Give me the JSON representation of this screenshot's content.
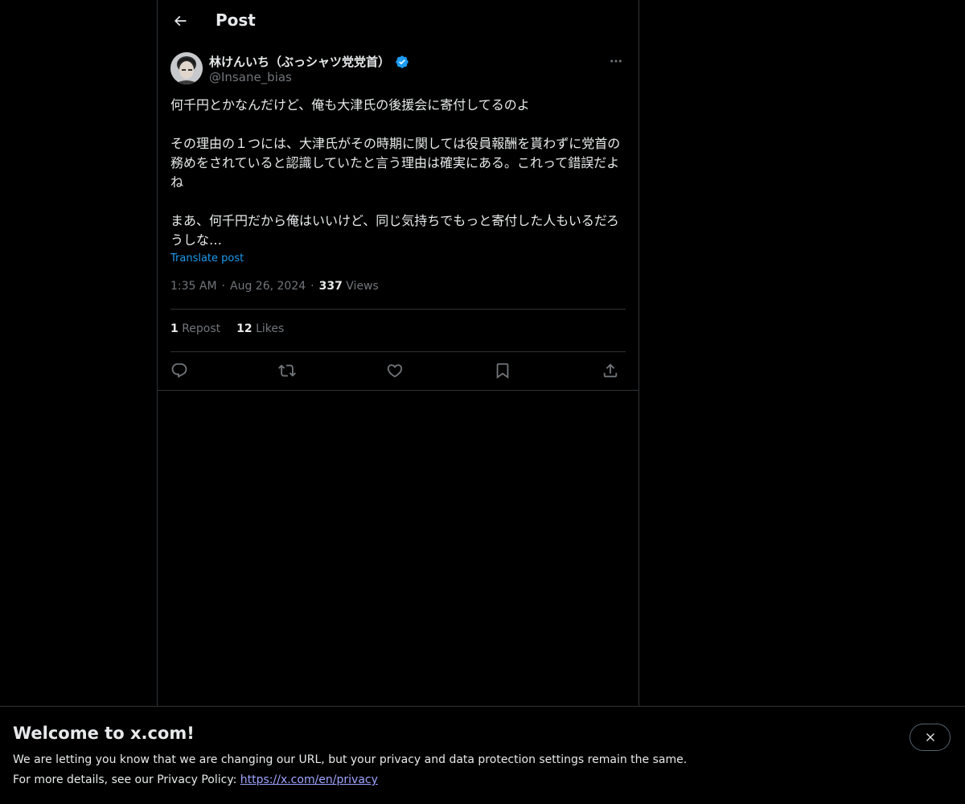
{
  "header": {
    "title": "Post",
    "back_icon": "arrow-left-icon"
  },
  "post": {
    "author": {
      "display_name": "林けんいち（ぶっシャツ党党首）",
      "handle": "@Insane_bias",
      "verified": true
    },
    "paragraphs": [
      "何千円とかなんだけど、俺も大津氏の後援会に寄付してるのよ",
      "その理由の１つには、大津氏がその時期に関しては役員報酬を貰わずに党首の務めをされていると認識していたと言う理由は確実にある。これって錯誤だよね",
      "まあ、何千円だから俺はいいけど、同じ気持ちでもっと寄付した人もいるだろうしな…"
    ],
    "translate_label": "Translate post",
    "time": "1:35 AM",
    "date": "Aug 26, 2024",
    "views_count": "337",
    "views_label": "Views",
    "reposts_count": "1",
    "reposts_label": "Repost",
    "likes_count": "12",
    "likes_label": "Likes"
  },
  "actions": [
    "reply-icon",
    "repost-icon",
    "like-icon",
    "bookmark-icon",
    "share-icon"
  ],
  "banner": {
    "title": "Welcome to x.com!",
    "line1": "We are letting you know that we are changing our URL, but your privacy and data protection settings remain the same.",
    "line2_prefix": "For more details, see our Privacy Policy: ",
    "link": "https://x.com/en/privacy",
    "close_icon": "close-icon"
  },
  "colors": {
    "background": "#000000",
    "text": "#e7e9ea",
    "secondary_text": "#71767b",
    "accent": "#1d9bf0",
    "border": "#2f3336",
    "link": "#a0a4ff"
  }
}
